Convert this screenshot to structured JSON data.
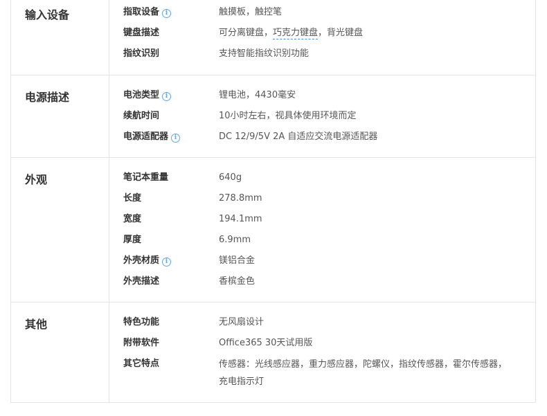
{
  "sections": [
    {
      "title": "输入设备",
      "rows": [
        {
          "label": "指取设备",
          "info": true,
          "value": "触摸板，触控笔"
        },
        {
          "label": "键盘描述",
          "info": false,
          "value_pre": "可分离键盘，",
          "value_link": "巧克力键盘",
          "value_post": "，背光键盘"
        },
        {
          "label": "指纹识别",
          "info": false,
          "value": "支持智能指纹识别功能"
        }
      ]
    },
    {
      "title": "电源描述",
      "rows": [
        {
          "label": "电池类型",
          "info": true,
          "value": "锂电池，4430毫安"
        },
        {
          "label": "续航时间",
          "info": false,
          "value": "10小时左右，视具体使用环境而定"
        },
        {
          "label": "电源适配器",
          "info": true,
          "value": "DC 12/9/5V 2A 自适应交流电源适配器"
        }
      ]
    },
    {
      "title": "外观",
      "rows": [
        {
          "label": "笔记本重量",
          "info": false,
          "value": "640g"
        },
        {
          "label": "长度",
          "info": false,
          "value": "278.8mm"
        },
        {
          "label": "宽度",
          "info": false,
          "value": "194.1mm"
        },
        {
          "label": "厚度",
          "info": false,
          "value": "6.9mm"
        },
        {
          "label": "外壳材质",
          "info": true,
          "value": "镁铝合金"
        },
        {
          "label": "外壳描述",
          "info": false,
          "value": "香槟金色"
        }
      ]
    },
    {
      "title": "其他",
      "rows": [
        {
          "label": "特色功能",
          "info": false,
          "value": "无风扇设计"
        },
        {
          "label": "附带软件",
          "info": false,
          "value": "Office365 30天试用版"
        },
        {
          "label": "其它特点",
          "info": false,
          "value": "传感器：光线感应器，重力感应器，陀螺仪，指纹传感器，霍尔传感器，充电指示灯"
        }
      ]
    }
  ],
  "info_icon_glyph": "i",
  "colors": {
    "border": "#e4e4e4",
    "info_icon": "#5fa7e8",
    "link_underline": "#4a8fd0"
  }
}
